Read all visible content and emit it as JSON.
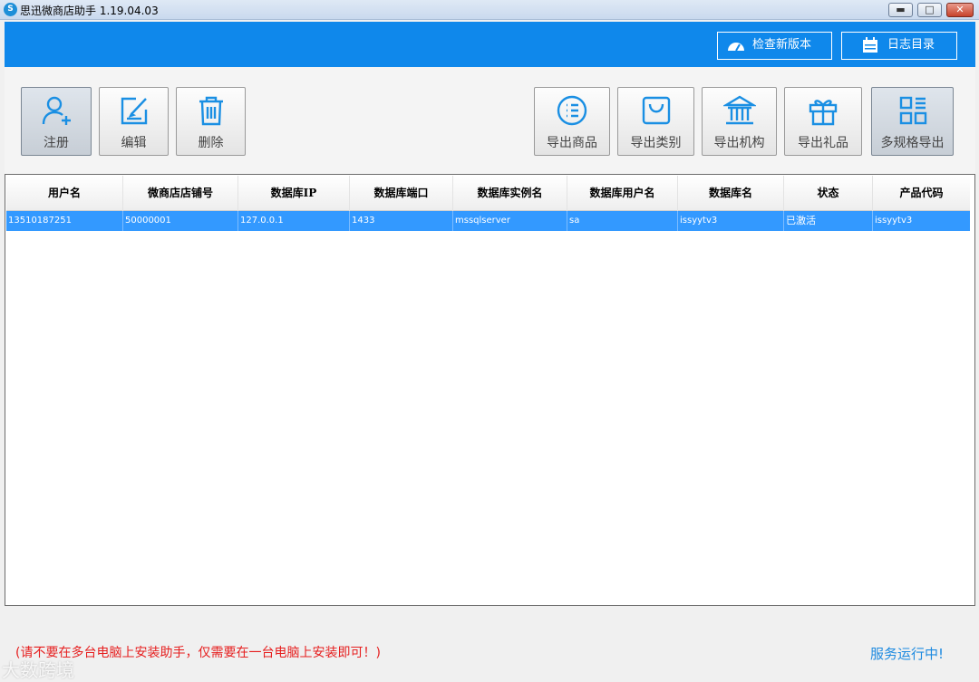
{
  "window": {
    "title": "思迅微商店助手 1.19.04.03",
    "icon": "app-logo-icon",
    "controls": [
      "minimize-icon",
      "maximize-icon",
      "close-icon"
    ]
  },
  "header": {
    "check_update_label": "检查新版本",
    "log_dir_label": "日志目录",
    "bg_color": "#0f88eb"
  },
  "toolbar": {
    "left": [
      {
        "label": "注册",
        "icon": "user-add-icon"
      },
      {
        "label": "编辑",
        "icon": "edit-icon"
      },
      {
        "label": "删除",
        "icon": "trash-icon"
      }
    ],
    "right": [
      {
        "label": "导出商品",
        "icon": "list-icon"
      },
      {
        "label": "导出类别",
        "icon": "bag-icon"
      },
      {
        "label": "导出机构",
        "icon": "bank-icon"
      },
      {
        "label": "导出礼品",
        "icon": "gift-icon"
      },
      {
        "label": "多规格导出",
        "icon": "grid-icon"
      }
    ]
  },
  "table": {
    "columns": [
      "用户名",
      "微商店店铺号",
      "数据库IP",
      "数据库端口",
      "数据库实例名",
      "数据库用户名",
      "数据库名",
      "状态",
      "产品代码"
    ],
    "rows": [
      [
        "13510187251",
        "50000001",
        "127.0.0.1",
        "1433",
        "mssqlserver",
        "sa",
        "issyytv3",
        "已激活",
        "issyytv3"
      ]
    ],
    "selected_row_color": "#3399ff"
  },
  "footer": {
    "notice": "(请不要在多台电脑上安装助手，仅需要在一台电脑上安装即可！)",
    "status": "服务运行中!",
    "notice_color": "#e61e1e",
    "status_color": "#1d8ae0"
  },
  "watermark": {
    "text": "大数跨境"
  }
}
